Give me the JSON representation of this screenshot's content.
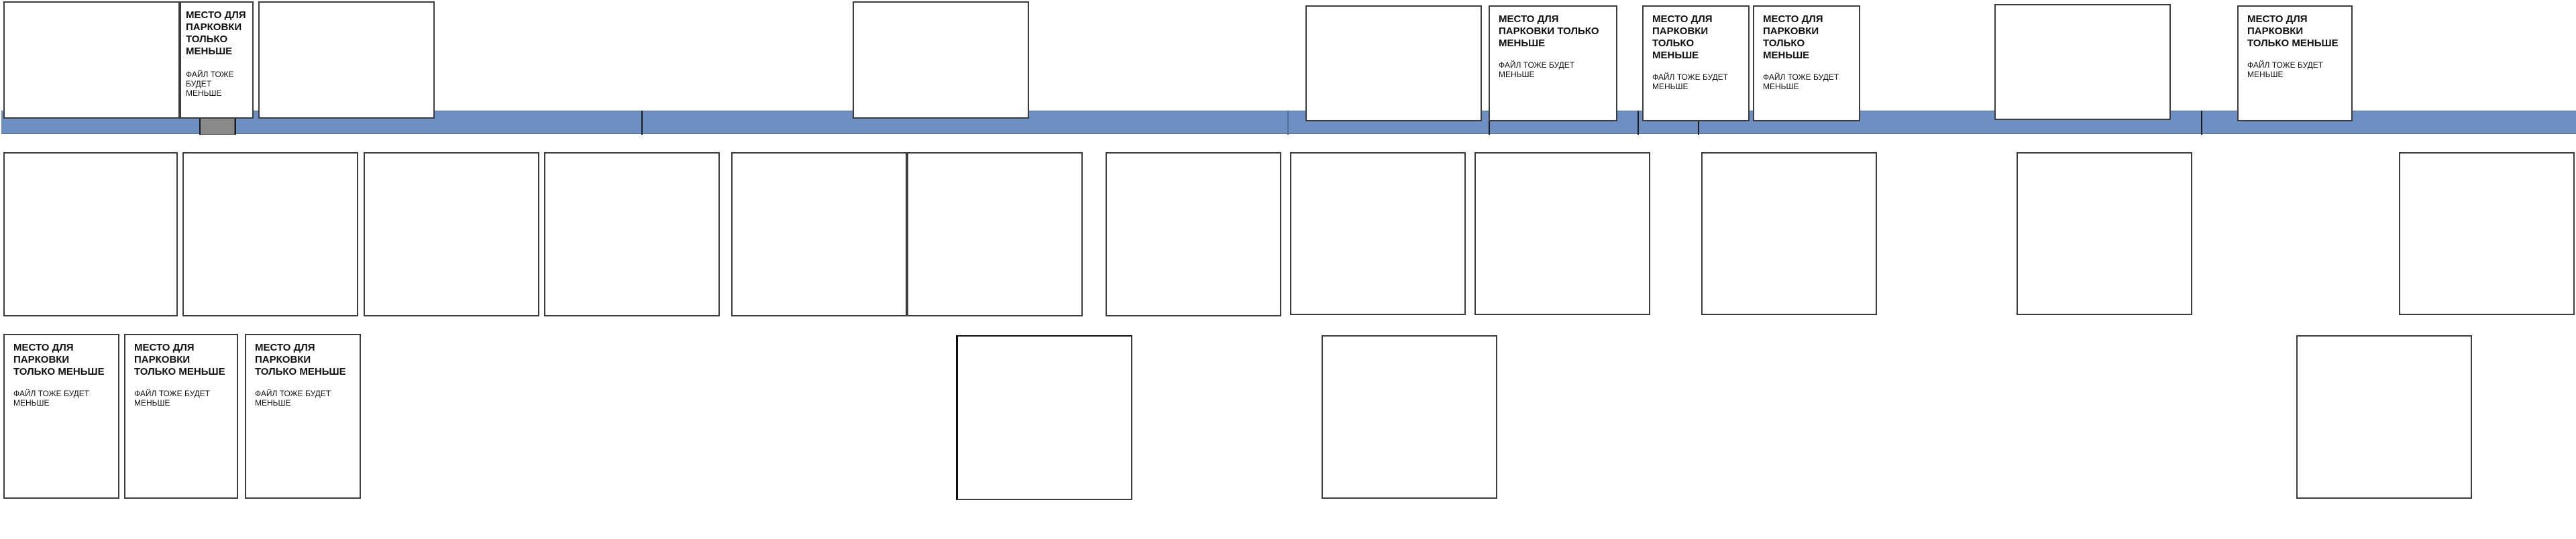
{
  "card": {
    "title": "МЕСТО ДЛЯ ПАРКОВКИ ТОЛЬКО МЕНЬШЕ",
    "note": "ФАЙЛ ТОЖЕ БУДЕТ МЕНЬШЕ"
  },
  "colors": {
    "strip": "#6d8fc2",
    "outline": "#3c3c3c",
    "marker": "#8a8a8a"
  }
}
